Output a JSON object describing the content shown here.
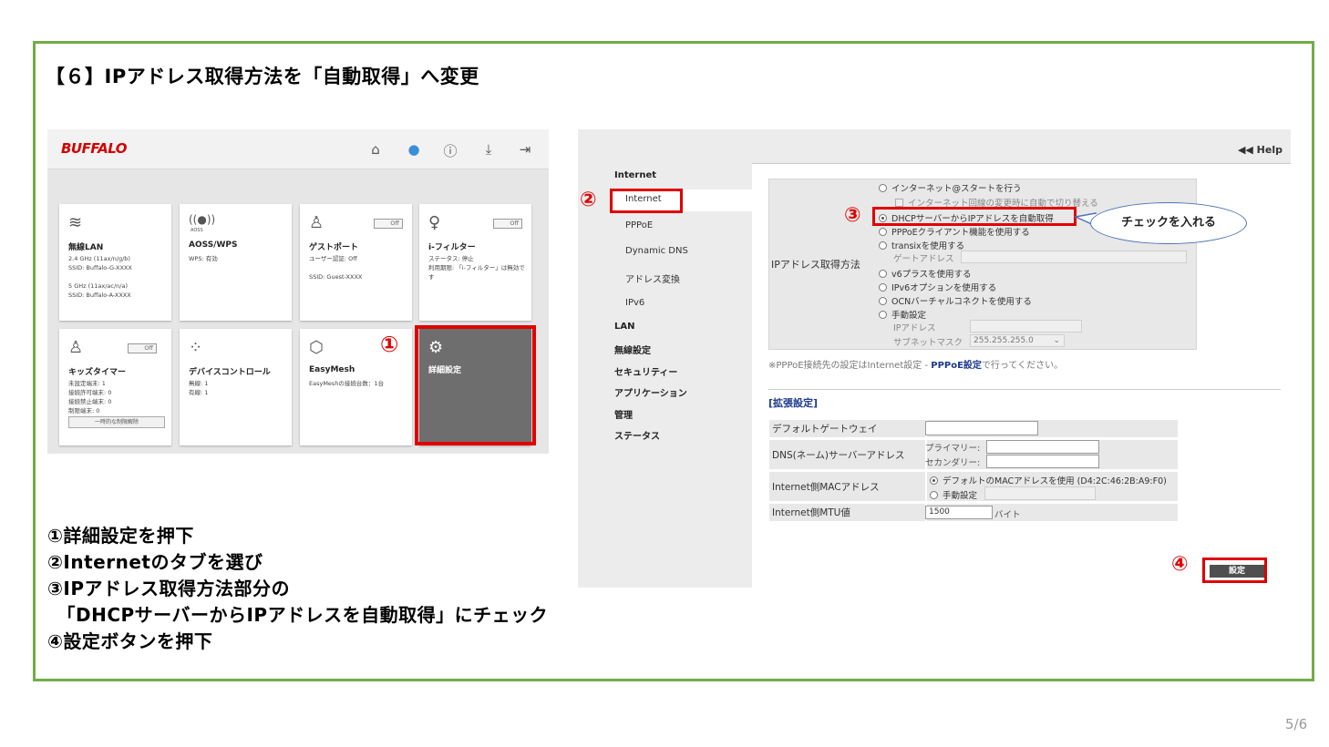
{
  "slide": {
    "title": "【６】IPアドレス取得方法を「自動取得」へ変更",
    "page": "5/6",
    "frame_color": "#70ad47"
  },
  "markers": {
    "m1": "①",
    "m2": "②",
    "m3": "③",
    "m4": "④",
    "color": "#e00000"
  },
  "dashboard": {
    "logo": "BUFFALO",
    "header_icons": [
      "home-icon",
      "globe-icon",
      "info-icon",
      "download-icon",
      "logout-icon"
    ],
    "tiles": [
      {
        "title": "無線LAN",
        "body": "2.4 GHz (11ax/n/g/b)\nSSID: Buffalo-G-XXXX\n\n5 GHz (11ax/ac/n/a)\nSSID: Buffalo-A-XXXX",
        "icon": "wifi-icon"
      },
      {
        "title": "AOSS/WPS",
        "body": "WPS: 有効",
        "icon": "aoss-icon",
        "icon_caption": "AOSS"
      },
      {
        "title": "ゲストポート",
        "body": "ユーザー認証: Off\n\nSSID: Guest-XXXX",
        "toggle": "Off",
        "icon": "guest-icon"
      },
      {
        "title": "i-フィルター",
        "body": "ステータス: 停止\n利用期限: 「i-フィルター」は無効です",
        "toggle": "Off",
        "icon": "filter-person-icon"
      },
      {
        "title": "キッズタイマー",
        "body": "未設定端末: 1\n接続許可端末: 0\n接続禁止端末: 0\n制限端末: 0",
        "toggle": "Off",
        "button": "一時的な制限解除",
        "icon": "kids-timer-icon"
      },
      {
        "title": "デバイスコントロール",
        "body": "無線: 1\n有線: 1",
        "icon": "device-control-icon"
      },
      {
        "title": "EasyMesh",
        "body": "EasyMeshの接続台数：1台",
        "icon": "easymesh-icon"
      },
      {
        "title": "詳細設定",
        "body": "",
        "icon": "gears-icon"
      }
    ]
  },
  "config": {
    "help": "◀◀ Help",
    "nav": {
      "internet_head": "Internet",
      "internet": "Internet",
      "pppoe": "PPPoE",
      "ddns": "Dynamic DNS",
      "nat": "アドレス変換",
      "ipv6": "IPv6",
      "lan": "LAN",
      "wireless": "無線設定",
      "security": "セキュリティー",
      "application": "アプリケーション",
      "admin": "管理",
      "status": "ステータス"
    },
    "ip_method_label": "IPアドレス取得方法",
    "options": {
      "opt1": "インターネット@スタートを行う",
      "opt1_sub": "インターネット回線の変更時に自動で切り替える",
      "opt2": "DHCPサーバーからIPアドレスを自動取得",
      "opt3": "PPPoEクライアント機能を使用する",
      "opt4": "transixを使用する",
      "opt4_gw": "ゲートアドレス",
      "opt5": "v6プラスを使用する",
      "opt6": "IPv6オプションを使用する",
      "opt7": "OCNバーチャルコネクトを使用する",
      "opt8": "手動設定",
      "opt8_ip": "IPアドレス",
      "opt8_mask": "サブネットマスク",
      "opt8_mask_value": "255.255.255.0"
    },
    "note_pre": "※PPPoE接続先の設定はInternet設定 - ",
    "note_link": "PPPoE設定",
    "note_post": "で行ってください。",
    "ext_title": "[拡張設定]",
    "ext": {
      "gateway": "デフォルトゲートウェイ",
      "dns": "DNS(ネーム)サーバーアドレス",
      "primary": "プライマリー:",
      "secondary": "セカンダリー:",
      "mac": "Internet側MACアドレス",
      "mac_default": "デフォルトのMACアドレスを使用 (D4:2C:46:2B:A9:F0)",
      "mac_manual": "手動設定",
      "mtu": "Internet側MTU値",
      "mtu_value": "1500",
      "mtu_unit": "バイト"
    },
    "set_button": "設定",
    "callout": "チェックを入れる"
  },
  "steps": [
    "①詳細設定を押下",
    "②Internetのタブを選び",
    "③IPアドレス取得方法部分の",
    "　「DHCPサーバーからIPアドレスを自動取得」にチェック",
    "④設定ボタンを押下"
  ]
}
